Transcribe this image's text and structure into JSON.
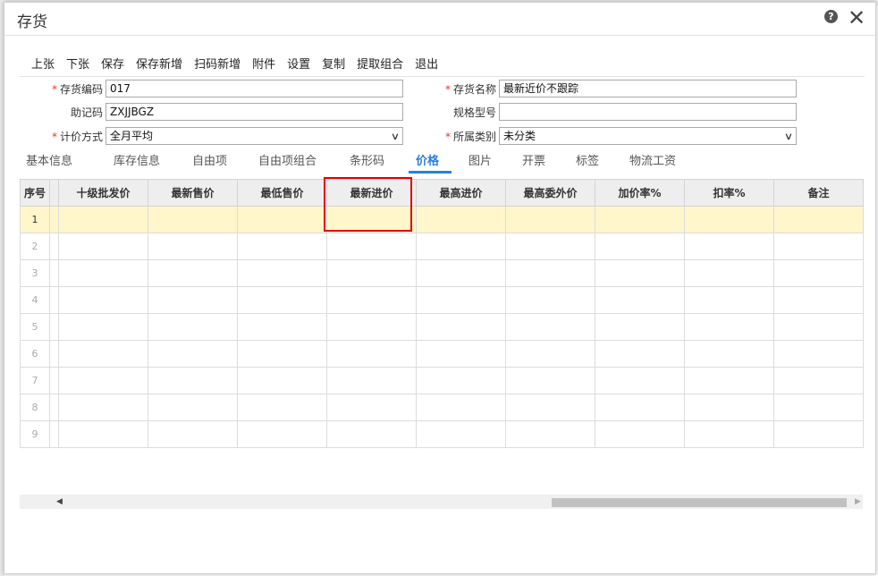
{
  "window": {
    "title": "存货"
  },
  "toolbar": [
    "上张",
    "下张",
    "保存",
    "保存新增",
    "扫码新增",
    "附件",
    "设置",
    "复制",
    "提取组合",
    "退出"
  ],
  "form": {
    "code": {
      "label": "存货编码",
      "value": "017"
    },
    "name": {
      "label": "存货名称",
      "value": "最新近价不跟踪"
    },
    "mnemonic": {
      "label": "助记码",
      "value": "ZXJJBGZ"
    },
    "spec": {
      "label": "规格型号",
      "value": ""
    },
    "pricing": {
      "label": "计价方式",
      "value": "全月平均"
    },
    "category": {
      "label": "所属类别",
      "value": "未分类"
    }
  },
  "tabs": [
    "基本信息",
    "库存信息",
    "自由项",
    "自由项组合",
    "条形码",
    "价格",
    "图片",
    "开票",
    "标签",
    "物流工资"
  ],
  "active_tab": "价格",
  "grid": {
    "columns": [
      "序号",
      "",
      "十级批发价",
      "最新售价",
      "最低售价",
      "最新进价",
      "最高进价",
      "最高委外价",
      "加价率%",
      "扣率%",
      "备注"
    ],
    "rows": [
      "1",
      "2",
      "3",
      "4",
      "5",
      "6",
      "7",
      "8",
      "9"
    ]
  }
}
